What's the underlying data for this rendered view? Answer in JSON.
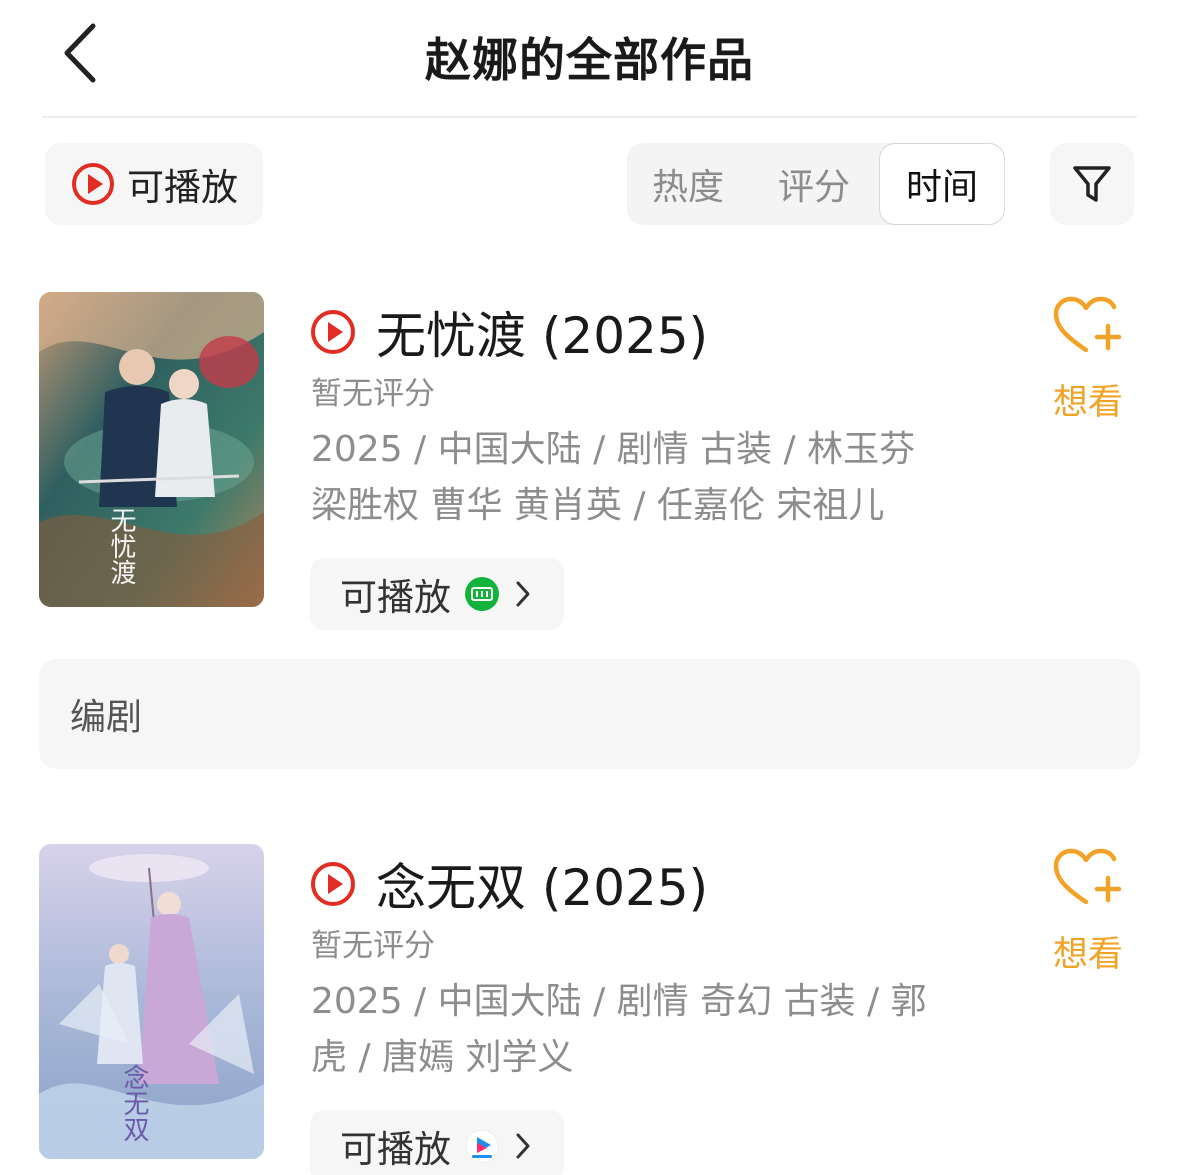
{
  "header": {
    "title": "赵娜的全部作品"
  },
  "toolbar": {
    "playable_label": "可播放",
    "sort_tabs": [
      "热度",
      "评分",
      "时间"
    ]
  },
  "movies": [
    {
      "title": "无忧渡 (2025)",
      "rating": "暂无评分",
      "meta_line1": "2025 / 中国大陆 / 剧情 古装 / 林玉芬",
      "meta_line2": "梁胜权 曹华 黄肖英 / 任嘉伦 宋祖儿",
      "play_label": "可播放",
      "play_source_icon": "iqiyi-icon",
      "want_label": "想看",
      "poster_overlay": "无忧渡"
    },
    {
      "title": "念无双 (2025)",
      "rating": "暂无评分",
      "meta_line1": "2025 / 中国大陆 / 剧情 奇幻 古装 / 郭",
      "meta_line2": "虎 / 唐嫣 刘学义",
      "play_label": "可播放",
      "play_source_icon": "youku-icon",
      "want_label": "想看",
      "poster_overlay": "念无双"
    }
  ],
  "role_section": {
    "label": "编剧"
  },
  "colors": {
    "accent_red": "#e02e24",
    "want_orange": "#f2a327",
    "iqiyi_green": "#12b33a"
  }
}
